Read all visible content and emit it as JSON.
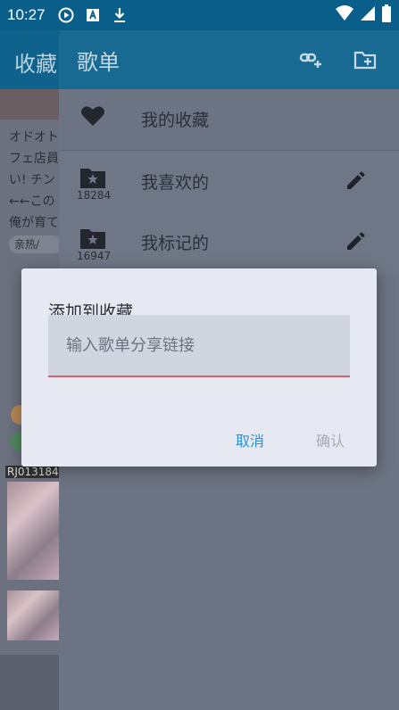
{
  "status_bar": {
    "time": "10:27",
    "icons": [
      "play-circle-icon",
      "a-badge-icon",
      "download-icon",
      "wifi-icon",
      "signal-icon",
      "battery-icon"
    ]
  },
  "background_screen": {
    "title": "收藏",
    "description_lines": [
      "オドオト",
      "フェ店員",
      "い! チン",
      "←←この",
      "俺が育て"
    ],
    "chip_label": "亲热/",
    "id_tag": "RJ013184"
  },
  "drawer": {
    "title": "歌单",
    "header_icons": [
      "link-add-icon",
      "folder-add-icon"
    ],
    "playlists": [
      {
        "label": "我的收藏",
        "icon": "heart-icon",
        "count": ""
      },
      {
        "label": "我喜欢的",
        "icon": "folder-star-icon",
        "count": "18284"
      },
      {
        "label": "我标记的",
        "icon": "folder-star-icon",
        "count": "16947"
      }
    ]
  },
  "dialog": {
    "title": "添加到收藏",
    "input_placeholder": "输入歌单分享链接",
    "input_value": "",
    "cancel_label": "取消",
    "confirm_label": "确认"
  },
  "colors": {
    "toolbar": "#196a93",
    "accent": "#2c8fd6",
    "input_underline": "#d16470",
    "scrim": "#6c7382"
  }
}
